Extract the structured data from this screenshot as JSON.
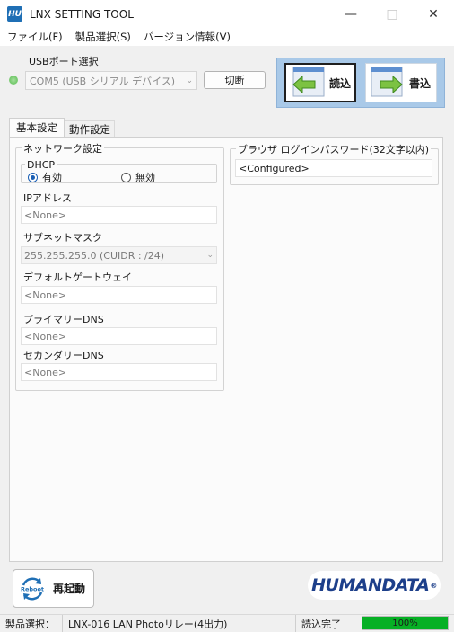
{
  "window": {
    "app_icon_text": "HU",
    "title": "LNX SETTING TOOL"
  },
  "menu": [
    "ファイル(F)",
    "製品選択(S)",
    "バージョン情報(V)"
  ],
  "usb": {
    "label": "USBポート選択",
    "port_value": "COM5 (USB シリアル デバイス)",
    "disconnect_label": "切断"
  },
  "actions": {
    "read_label": "読込",
    "write_label": "書込"
  },
  "tabs": [
    "基本設定",
    "動作設定"
  ],
  "network": {
    "title": "ネットワーク設定",
    "dhcp": {
      "title": "DHCP",
      "enabled_label": "有効",
      "disabled_label": "無効",
      "selected": "有効"
    },
    "ip_label": "IPアドレス",
    "ip_value": "<None>",
    "subnet_label": "サブネットマスク",
    "subnet_value": "255.255.255.0 (CUIDR : /24)",
    "gateway_label": "デフォルトゲートウェイ",
    "gateway_value": "<None>",
    "dns1_label": "プライマリーDNS",
    "dns1_value": "<None>",
    "dns2_label": "セカンダリーDNS",
    "dns2_value": "<None>"
  },
  "password": {
    "title": "ブラウザ ログインパスワード(32文字以内)",
    "value": "<Configured>"
  },
  "reboot": {
    "icon_text": "Reboot",
    "label": "再起動"
  },
  "logo": {
    "text": "HUMANDATA",
    "mark": "®"
  },
  "status": {
    "product_label": "製品選択：",
    "product_value": "LNX-016 LAN Photoリレー(4出力)",
    "state": "読込完了",
    "progress_text": "100%",
    "progress_percent": 100
  },
  "colors": {
    "accent": "#1a5fb4",
    "progress": "#06b025",
    "action_panel": "#a9c9e8",
    "logo": "#1d3f8a"
  }
}
